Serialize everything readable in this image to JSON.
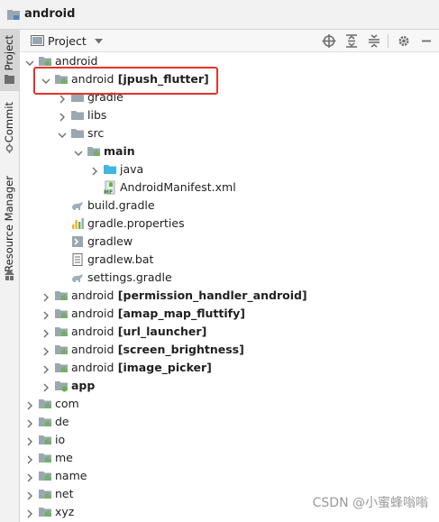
{
  "window": {
    "title": "android"
  },
  "side_tabs": {
    "project": "Project",
    "commit": "Commit",
    "resource_manager": "Resource Manager"
  },
  "toolbar": {
    "view_label": "Project"
  },
  "tree": [
    {
      "name": "android",
      "suffix": "",
      "depth": 0,
      "expanded": true,
      "icon": "module-folder-icon"
    },
    {
      "name": "android",
      "suffix": "[jpush_flutter]",
      "depth": 1,
      "expanded": true,
      "icon": "module-folder-icon"
    },
    {
      "name": "gradle",
      "suffix": "",
      "depth": 2,
      "expanded": false,
      "icon": "folder-icon"
    },
    {
      "name": "libs",
      "suffix": "",
      "depth": 2,
      "expanded": false,
      "icon": "folder-icon"
    },
    {
      "name": "src",
      "suffix": "",
      "depth": 2,
      "expanded": true,
      "icon": "folder-icon"
    },
    {
      "name": "main",
      "suffix": "",
      "depth": 3,
      "expanded": true,
      "icon": "module-folder-icon",
      "bold": true
    },
    {
      "name": "java",
      "suffix": "",
      "depth": 4,
      "expanded": false,
      "icon": "source-folder-icon"
    },
    {
      "name": "AndroidManifest.xml",
      "suffix": "",
      "depth": 4,
      "leaf": true,
      "icon": "manifest-file-icon"
    },
    {
      "name": "build.gradle",
      "suffix": "",
      "depth": 2,
      "leaf": true,
      "icon": "gradle-file-icon"
    },
    {
      "name": "gradle.properties",
      "suffix": "",
      "depth": 2,
      "leaf": true,
      "icon": "properties-file-icon"
    },
    {
      "name": "gradlew",
      "suffix": "",
      "depth": 2,
      "leaf": true,
      "icon": "script-file-icon"
    },
    {
      "name": "gradlew.bat",
      "suffix": "",
      "depth": 2,
      "leaf": true,
      "icon": "text-file-icon"
    },
    {
      "name": "settings.gradle",
      "suffix": "",
      "depth": 2,
      "leaf": true,
      "icon": "gradle-file-icon"
    },
    {
      "name": "android",
      "suffix": "[permission_handler_android]",
      "depth": 1,
      "expanded": false,
      "icon": "module-folder-icon"
    },
    {
      "name": "android",
      "suffix": "[amap_map_fluttify]",
      "depth": 1,
      "expanded": false,
      "icon": "module-folder-icon"
    },
    {
      "name": "android",
      "suffix": "[url_launcher]",
      "depth": 1,
      "expanded": false,
      "icon": "module-folder-icon"
    },
    {
      "name": "android",
      "suffix": "[screen_brightness]",
      "depth": 1,
      "expanded": false,
      "icon": "module-folder-icon"
    },
    {
      "name": "android",
      "suffix": "[image_picker]",
      "depth": 1,
      "expanded": false,
      "icon": "module-folder-icon"
    },
    {
      "name": "app",
      "suffix": "",
      "depth": 1,
      "expanded": false,
      "icon": "app-module-icon",
      "bold": true
    },
    {
      "name": "com",
      "suffix": "",
      "depth": 0,
      "expanded": false,
      "icon": "module-folder-icon"
    },
    {
      "name": "de",
      "suffix": "",
      "depth": 0,
      "expanded": false,
      "icon": "module-folder-icon"
    },
    {
      "name": "io",
      "suffix": "",
      "depth": 0,
      "expanded": false,
      "icon": "module-folder-icon"
    },
    {
      "name": "me",
      "suffix": "",
      "depth": 0,
      "expanded": false,
      "icon": "module-folder-icon"
    },
    {
      "name": "name",
      "suffix": "",
      "depth": 0,
      "expanded": false,
      "icon": "module-folder-icon"
    },
    {
      "name": "net",
      "suffix": "",
      "depth": 0,
      "expanded": false,
      "icon": "module-folder-icon"
    },
    {
      "name": "xyz",
      "suffix": "",
      "depth": 0,
      "expanded": false,
      "icon": "module-folder-icon"
    }
  ],
  "watermark": "CSDN @小蜜蜂嗡嗡",
  "colors": {
    "highlight": "#e6332a",
    "folder": "#9aa7b0",
    "source_folder": "#40b6e0",
    "module_bars": "#62b543",
    "gradle": "#6e8c99"
  }
}
